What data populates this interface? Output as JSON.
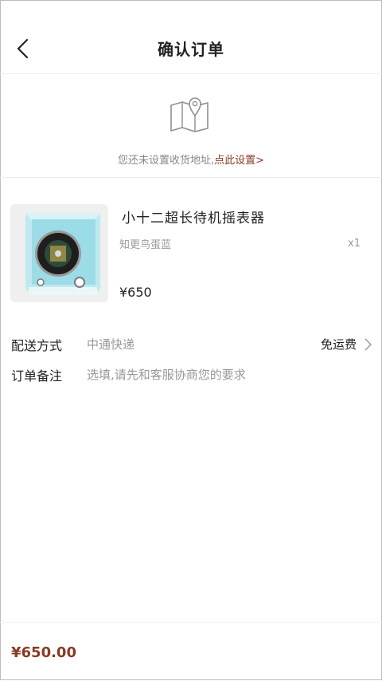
{
  "header": {
    "title": "确认订单",
    "back_icon": "chevron-left-icon"
  },
  "address": {
    "icon": "map-pin-icon",
    "notice": "您还未设置收货地址,",
    "link": "点此设置>",
    "link_color": "#8a3a24"
  },
  "product": {
    "name": "小十二超长待机摇表器",
    "spec": "知更鸟蛋蓝",
    "quantity": "x1",
    "price": "¥650",
    "image_icon": "watch-winder-image"
  },
  "delivery": {
    "label": "配送方式",
    "value": "中通快递",
    "fee": "免运费",
    "chevron_icon": "chevron-right-icon"
  },
  "remark": {
    "label": "订单备注",
    "placeholder": "选填,请先和客服协商您的要求"
  },
  "footer": {
    "total": "¥650.00"
  },
  "colors": {
    "accent": "#8a3a24",
    "muted": "#999999",
    "divider": "#ededed"
  }
}
